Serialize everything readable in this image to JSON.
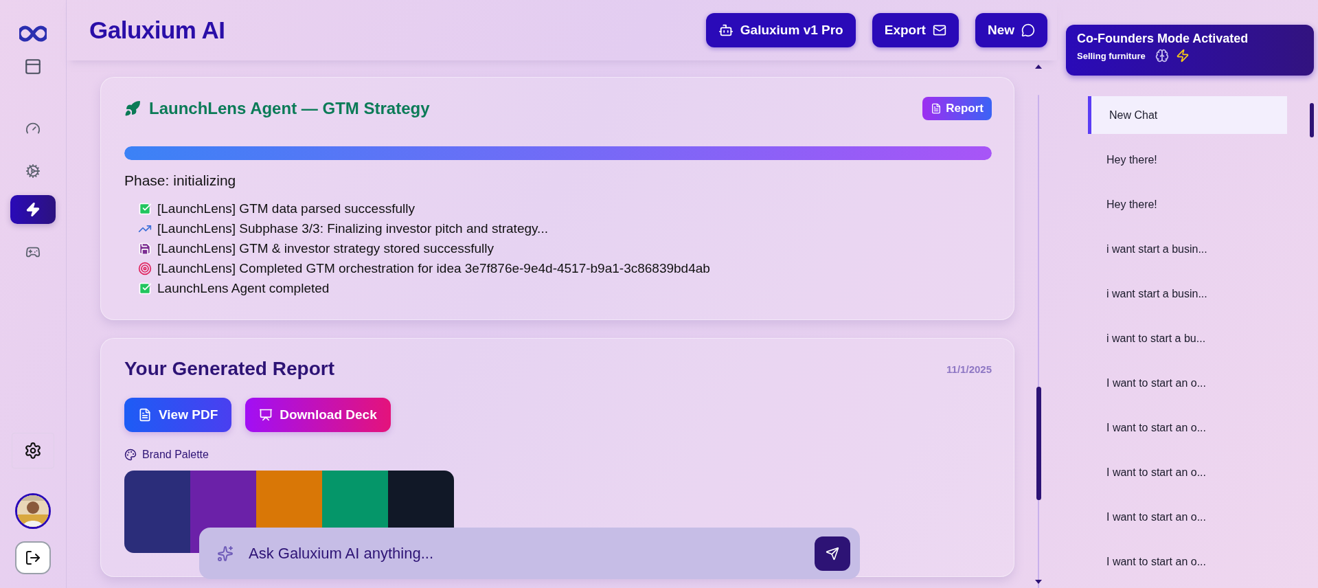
{
  "app": {
    "title": "Galuxium AI"
  },
  "nav": [
    {
      "kind": "dashboard",
      "selected": false
    },
    {
      "kind": "gears",
      "selected": false
    },
    {
      "kind": "bolt",
      "selected": true
    },
    {
      "kind": "gamepad",
      "selected": false
    }
  ],
  "header_buttons": [
    {
      "kind": "robot",
      "label": "Galuxium v1 Pro"
    },
    {
      "kind": "export",
      "label": "Export"
    },
    {
      "kind": "messenger",
      "label": "New"
    }
  ],
  "mode_card": {
    "title": "Co-Founders Mode Activated",
    "subtitle": "Selling furniture"
  },
  "agent_card": {
    "title": "LaunchLens Agent — GTM Strategy",
    "report_button": "Report",
    "level": 1,
    "phase": "Phase: initializing",
    "log": [
      {
        "kind": "success",
        "text": "[LaunchLens] GTM data parsed successfully"
      },
      {
        "kind": "progress",
        "text": "[LaunchLens] Subphase 3/3: Finalizing investor pitch and strategy..."
      },
      {
        "kind": "saved",
        "text": "[LaunchLens] GTM & investor strategy stored successfully"
      },
      {
        "kind": "target",
        "text": "[LaunchLens] Completed GTM orchestration for idea 3e7f876e-9e4d-4517-b9a1-3c86839bd4ab"
      },
      {
        "kind": "success",
        "text": "LaunchLens Agent completed"
      }
    ]
  },
  "report_card": {
    "title": "Your Generated Report",
    "date": "11/1/2025",
    "buttons": [
      {
        "kind": "pdf",
        "label": "View PDF"
      },
      {
        "kind": "deck",
        "label": "Download Deck"
      }
    ],
    "palette_label": "Brand Palette",
    "palette": [
      {
        "color": "#2b2d7a"
      },
      {
        "color": "#6b21a8"
      },
      {
        "color": "#d97706"
      },
      {
        "color": "#059669"
      },
      {
        "color": "#111827"
      }
    ]
  },
  "composer": {
    "placeholder": "Ask Galuxium AI anything..."
  },
  "chats": [
    {
      "label": "New Chat",
      "selected": true
    },
    {
      "label": "Hey there!",
      "selected": false
    },
    {
      "label": "Hey there!",
      "selected": false
    },
    {
      "label": "i want start a busin...",
      "selected": false
    },
    {
      "label": "i want start a busin...",
      "selected": false
    },
    {
      "label": "i want to start a bu...",
      "selected": false
    },
    {
      "label": "I want to start an o...",
      "selected": false
    },
    {
      "label": "I want to start an o...",
      "selected": false
    },
    {
      "label": "I want to start an o...",
      "selected": false
    },
    {
      "label": "I want to start an o...",
      "selected": false
    },
    {
      "label": "I want to start an o...",
      "selected": false
    }
  ]
}
